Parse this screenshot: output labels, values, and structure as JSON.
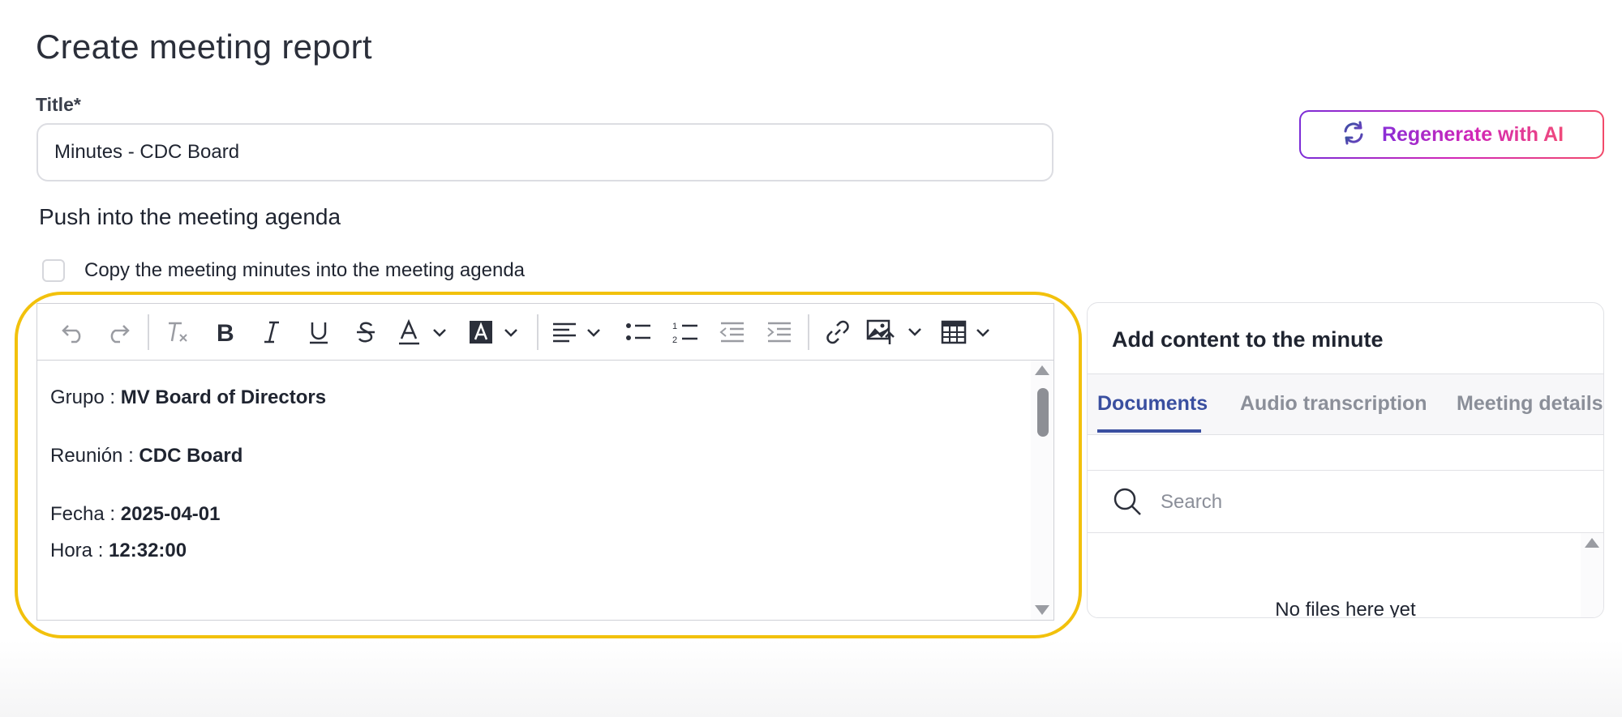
{
  "page": {
    "title": "Create meeting report"
  },
  "title_field": {
    "label": "Title*",
    "value": "Minutes - CDC Board"
  },
  "regenerate": {
    "label": "Regenerate with AI"
  },
  "agenda": {
    "heading": "Push into the meeting agenda",
    "checkbox_label": "Copy the meeting minutes into the meeting agenda",
    "checked": false
  },
  "editor": {
    "toolbar": [
      "undo-icon",
      "redo-icon",
      "clear-format-icon",
      "bold-icon",
      "italic-icon",
      "underline-icon",
      "strikethrough-icon",
      "text-color-icon",
      "highlight-color-icon",
      "align-icon",
      "bullet-list-icon",
      "numbered-list-icon",
      "outdent-icon",
      "indent-icon",
      "link-icon",
      "image-icon",
      "table-icon"
    ],
    "lines": [
      {
        "label": "Grupo : ",
        "value": "MV Board of Directors"
      },
      {
        "label": "Reunión : ",
        "value": "CDC Board"
      },
      {
        "label": "Fecha : ",
        "value": "2025-04-01"
      },
      {
        "label": "Hora : ",
        "value": "12:32:00"
      }
    ]
  },
  "side_panel": {
    "title": "Add content to the minute",
    "tabs": [
      "Documents",
      "Audio transcription",
      "Meeting details"
    ],
    "active_tab": "Documents",
    "search_placeholder": "Search",
    "empty_message": "No files here yet"
  },
  "colors": {
    "accent_tab": "#3a4fa0",
    "highlight_border": "#f2c10c",
    "ai_gradient_start": "#7b2cd6",
    "ai_gradient_end": "#f24a6a"
  }
}
